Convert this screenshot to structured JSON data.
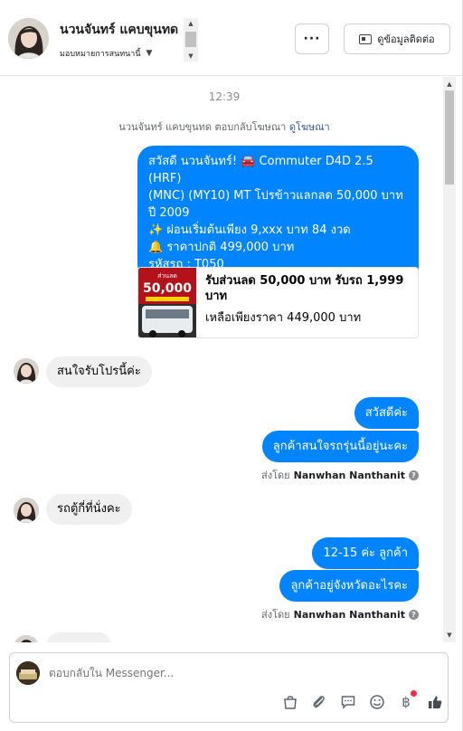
{
  "header": {
    "contact_name": "นวนจันทร์ แคบขุนทด",
    "assign_label": "มอบหมายการสนทนานี้",
    "more_label": "···",
    "view_contact_label": "ดูข้อมูลติดต่อ"
  },
  "chat": {
    "timestamp": "12:39",
    "ad_reply_text": "นวนจันทร์ แคบขุนทด ตอบกลับโฆษณา",
    "ad_reply_link": "ดูโฆษณา",
    "intro_lines": [
      "สวัสดี นวนจันทร์! 🚘 Commuter D4D 2.5 (HRF)",
      "(MNC) (MY10) MT โปรข้าวแลกลด 50,000 บาท",
      "ปี 2009",
      "✨  ผ่อนเริ่มต้นเพียง 9,xxx บาท  84 งวด",
      "🔔  ราคาปกติ 499,000 บาท",
      "รหัสรถ : T050"
    ],
    "card": {
      "title": "รับส่วนลด 50,000 บาท รับรถ 1,999 บาท",
      "subtitle": "เหลือเพียงราคา 449,000 บาท",
      "thumb_text": "50,000"
    },
    "messages": {
      "in_1": "สนใจรับโปรนี้ค่ะ",
      "out_1": "สวัสดีค่ะ",
      "out_2": "ลูกค้าสนใจรถรุ่นนี้อยู่นะคะ",
      "in_2": "รถตู้กี่ที่นั่งคะ",
      "out_3": "12-15 ค่ะ ลูกค้า",
      "out_4": "ลูกค้าอยู่จังหวัดอะไรคะ"
    },
    "sent_by_label": "ส่งโดย",
    "sent_by_name": "Nanwhan Nanthanit"
  },
  "composer": {
    "placeholder": "ตอบกลับใน Messenger...",
    "icons": [
      "bag-icon",
      "attachment-icon",
      "saved-reply-icon",
      "emoji-icon",
      "baht-icon",
      "like-icon"
    ]
  },
  "colors": {
    "accent": "#0084ff",
    "incoming_bubble": "#f0f0f0",
    "notification_dot": "#f02849"
  }
}
